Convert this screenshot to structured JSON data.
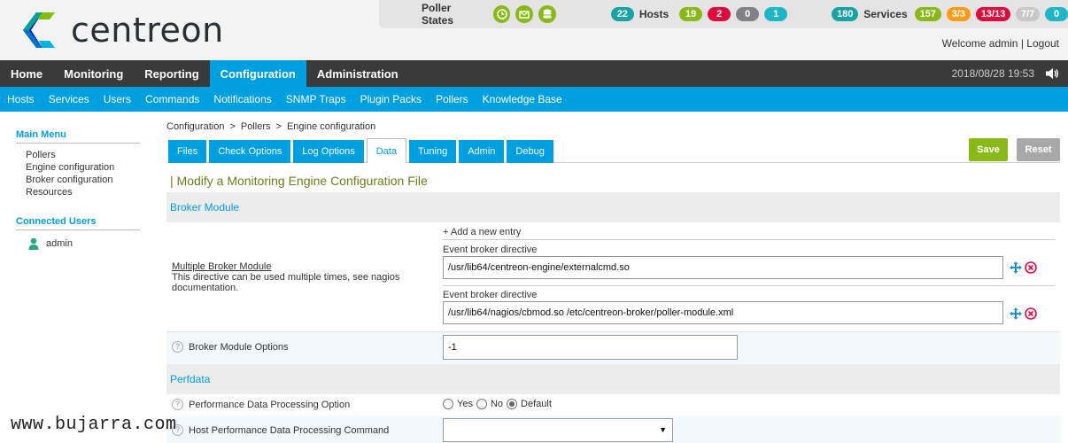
{
  "brand": {
    "name": "centreon"
  },
  "topbar": {
    "poller_states_label": "Poller States",
    "hosts": {
      "label": "Hosts",
      "total": "22",
      "up": "19",
      "down": "2",
      "unreachable": "0",
      "pending": "1"
    },
    "services": {
      "label": "Services",
      "total": "180",
      "ok": "157",
      "warning": "3/3",
      "critical": "13/13",
      "unknown": "7/7",
      "pending": "0"
    }
  },
  "user": {
    "welcome": "Welcome admin",
    "separator": "|",
    "logout": "Logout"
  },
  "main_nav": {
    "items": [
      "Home",
      "Monitoring",
      "Reporting",
      "Configuration",
      "Administration"
    ],
    "active": "Configuration",
    "datetime": "2018/08/28 19:53"
  },
  "sub_nav": {
    "items": [
      "Hosts",
      "Services",
      "Users",
      "Commands",
      "Notifications",
      "SNMP Traps",
      "Plugin Packs",
      "Pollers",
      "Knowledge Base"
    ]
  },
  "sidebar": {
    "main_menu_title": "Main Menu",
    "main_menu_items": [
      "Pollers",
      "Engine configuration",
      "Broker configuration",
      "Resources"
    ],
    "connected_title": "Connected Users",
    "connected_users": [
      "admin"
    ]
  },
  "breadcrumb": [
    "Configuration",
    "Pollers",
    "Engine configuration"
  ],
  "breadcrumb_sep": ">",
  "tabs": [
    "Files",
    "Check Options",
    "Log Options",
    "Data",
    "Tuning",
    "Admin",
    "Debug"
  ],
  "active_tab": "Data",
  "actions": {
    "save": "Save",
    "reset": "Reset"
  },
  "form": {
    "title": "| Modify a Monitoring Engine Configuration File",
    "sections": {
      "broker": "Broker Module",
      "perfdata": "Perfdata"
    },
    "multiple_broker": {
      "label": "Multiple Broker Module",
      "description": "This directive can be used multiple times, see nagios documentation.",
      "add_entry": "+ Add a new entry",
      "entries": [
        {
          "label": "Event broker directive",
          "value": "/usr/lib64/centreon-engine/externalcmd.so"
        },
        {
          "label": "Event broker directive",
          "value": "/usr/lib64/nagios/cbmod.so /etc/centreon-broker/poller-module.xml"
        }
      ]
    },
    "broker_options": {
      "label": "Broker Module Options",
      "value": "-1"
    },
    "perf_processing": {
      "label": "Performance Data Processing Option",
      "options": [
        "Yes",
        "No",
        "Default"
      ],
      "selected": "Default"
    },
    "host_perf_command": {
      "label": "Host Performance Data Processing Command",
      "value": ""
    },
    "help_glyph": "?"
  },
  "watermark": "www.bujarra.com",
  "colors": {
    "accent": "#009fdf",
    "nav_dark": "#3a3a3a",
    "save": "#88b917",
    "title": "#6e7d17"
  }
}
